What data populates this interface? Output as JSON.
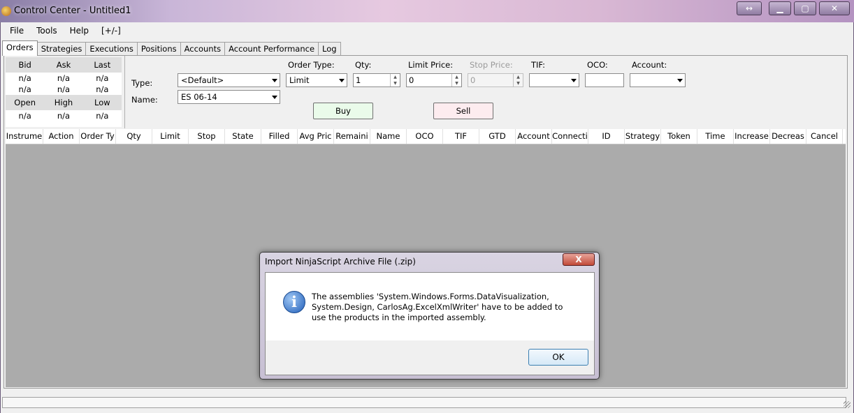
{
  "window": {
    "title": "Control Center - Untitled1"
  },
  "menu": [
    "File",
    "Tools",
    "Help",
    "[+/-]"
  ],
  "tabs": [
    "Orders",
    "Strategies",
    "Executions",
    "Positions",
    "Accounts",
    "Account Performance",
    "Log"
  ],
  "quote": {
    "headers1": [
      "Bid",
      "Ask",
      "Last"
    ],
    "rows1": [
      [
        "n/a",
        "n/a",
        "n/a"
      ],
      [
        "n/a",
        "n/a",
        "n/a"
      ]
    ],
    "headers2": [
      "Open",
      "High",
      "Low"
    ],
    "rows2": [
      [
        "n/a",
        "n/a",
        "n/a"
      ]
    ]
  },
  "order": {
    "type_label": "Type:",
    "type_value": "<Default>",
    "name_label": "Name:",
    "name_value": "ES 06-14",
    "order_type_label": "Order Type:",
    "order_type_value": "Limit",
    "qty_label": "Qty:",
    "qty_value": "1",
    "limit_label": "Limit Price:",
    "limit_value": "0",
    "stop_label": "Stop Price:",
    "stop_value": "0",
    "tif_label": "TIF:",
    "tif_value": "",
    "oco_label": "OCO:",
    "oco_value": "",
    "account_label": "Account:",
    "account_value": "",
    "buy": "Buy",
    "sell": "Sell"
  },
  "grid": {
    "columns": [
      "Instrume",
      "Action",
      "Order Ty",
      "Qty",
      "Limit",
      "Stop",
      "State",
      "Filled",
      "Avg Pric",
      "Remaini",
      "Name",
      "OCO",
      "TIF",
      "GTD",
      "Account",
      "Connecti",
      "ID",
      "Strategy",
      "Token",
      "Time",
      "Increase",
      "Decreas",
      "Cancel"
    ]
  },
  "dialog": {
    "title": "Import NinjaScript Archive File (.zip)",
    "close": "X",
    "message": "The assemblies 'System.Windows.Forms.DataVisualization, System.Design, CarlosAg.ExcelXmlWriter' have to be added to use the products in the imported assembly.",
    "ok": "OK"
  },
  "icons": {
    "app": "ninjatrader-icon",
    "dialog": "info-icon"
  },
  "colors": {
    "buy_bg": "#eafbea",
    "sell_bg": "#fdecef",
    "grid_bg": "#ababab"
  }
}
